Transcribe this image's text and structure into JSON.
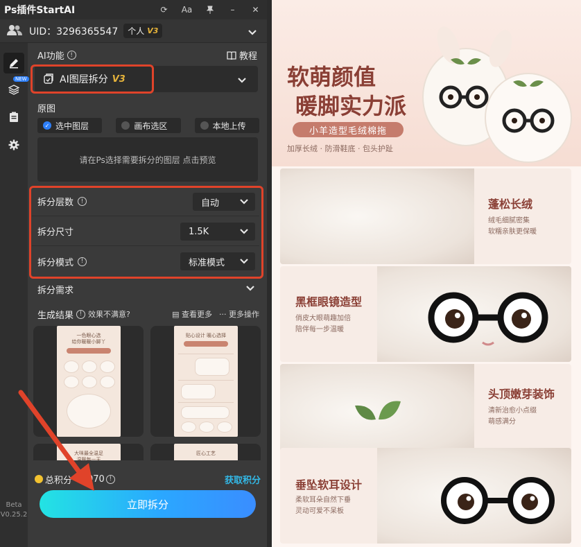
{
  "panel": {
    "title": "Ps插件StartAI",
    "tools": [
      "⟳",
      "Aa",
      "📌",
      "–",
      "✕"
    ],
    "uid": "UID：3296365547",
    "plan": "个人",
    "plan_version": "V3",
    "ai_function_label": "AI功能",
    "tutorial_label": "教程",
    "function_selected": "AI图层拆分",
    "function_version": "V3",
    "source_label": "原图",
    "source_options": [
      "选中图层",
      "画布选区",
      "本地上传"
    ],
    "preview_hint": "请在Ps选择需要拆分的图层 点击预览",
    "params": [
      {
        "label": "拆分层数",
        "value": "自动",
        "has_info": true
      },
      {
        "label": "拆分尺寸",
        "value": "1.5K",
        "has_info": false
      },
      {
        "label": "拆分模式",
        "value": "标准模式",
        "has_info": true
      }
    ],
    "demand_label": "拆分需求",
    "results_label": "生成结果",
    "unsatisfied": "效果不满意?",
    "view_more": "查看更多",
    "more_ops": "··· 更多操作",
    "points_label": "总积分",
    "points_value": "070",
    "get_points": "获取积分",
    "split_button": "立即拆分",
    "beta_label": "Beta",
    "version": "V0.25.2",
    "new_badge": "NEW",
    "accent": "#2d7ff9",
    "highlight_red": "#e0432a"
  },
  "thumbs": [
    {
      "title": "一色眼心选\n给你暖暖小脚丫"
    },
    {
      "title": "贴心设计 暖心选择"
    },
    {
      "title": "大咪最全温足\n温暖每一天"
    },
    {
      "title": "匠心工艺"
    }
  ],
  "canvas": {
    "hero_title_1": "软萌颜值",
    "hero_title_2": "暖脚实力派",
    "hero_band": "小羊造型毛绒棉拖",
    "hero_sub": "加厚长绒 · 防滑鞋底 · 包头护趾",
    "features": [
      {
        "title": "蓬松长绒",
        "desc1": "绒毛细腻密集",
        "desc2": "软糯亲肤更保暖"
      },
      {
        "title": "黑框眼镜造型",
        "desc1": "俏皮大眼萌趣加倍",
        "desc2": "陪伴每一步温暖"
      },
      {
        "title": "头顶嫩芽装饰",
        "desc1": "清新治愈小点缀",
        "desc2": "萌感满分"
      },
      {
        "title": "垂坠软耳设计",
        "desc1": "柔软耳朵自然下垂",
        "desc2": "灵动可爱不呆板"
      }
    ]
  }
}
